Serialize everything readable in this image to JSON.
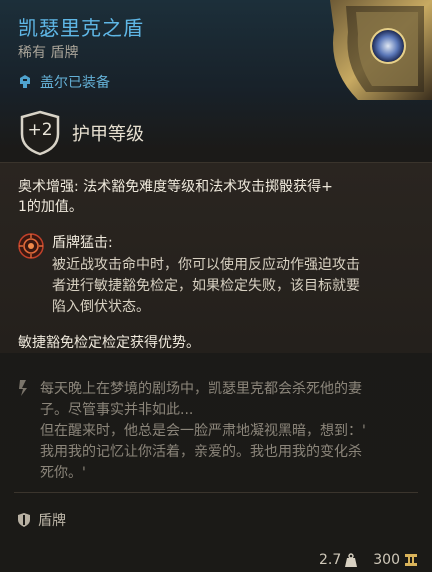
{
  "item": {
    "name": "凯瑟里克之盾",
    "subtitle": "稀有 盾牌",
    "equipped_by": "盖尔已装备"
  },
  "armor": {
    "bonus": "+2",
    "label": "护甲等级"
  },
  "effects": {
    "arcane_line1": "奥术增强: 法术豁免难度等级和法术攻击掷骰获得+",
    "arcane_line2": "1的加值。",
    "shield_bash_title": "盾牌猛击:",
    "shield_bash_line1": "被近战攻击命中时，你可以使用反应动作强迫攻击",
    "shield_bash_line2": "者进行敏捷豁免检定，如果检定失败，该目标就要",
    "shield_bash_line3": "陷入倒伏状态。",
    "dex_advantage": "敏捷豁免检定检定获得优势。"
  },
  "lore": {
    "line1": "每天晚上在梦境的剧场中，凯瑟里克都会杀死他的妻",
    "line2": "子。尽管事实并非如此...",
    "line3": "但在醒来时，他总是会一脸严肃地凝视黑暗，想到：'",
    "line4": "我用我的记忆让你活着，亲爱的。我也用我的变化杀",
    "line5": "死你。'"
  },
  "item_type": "盾牌",
  "footer": {
    "weight": "2.7",
    "value": "300"
  },
  "colors": {
    "name": "#5fb7e6",
    "equipped": "#64b0d6"
  },
  "icons": [
    "helm-icon",
    "shield-badge-icon",
    "shield-bash-icon",
    "quote-icon",
    "shield-type-icon",
    "weight-icon",
    "gold-icon"
  ]
}
